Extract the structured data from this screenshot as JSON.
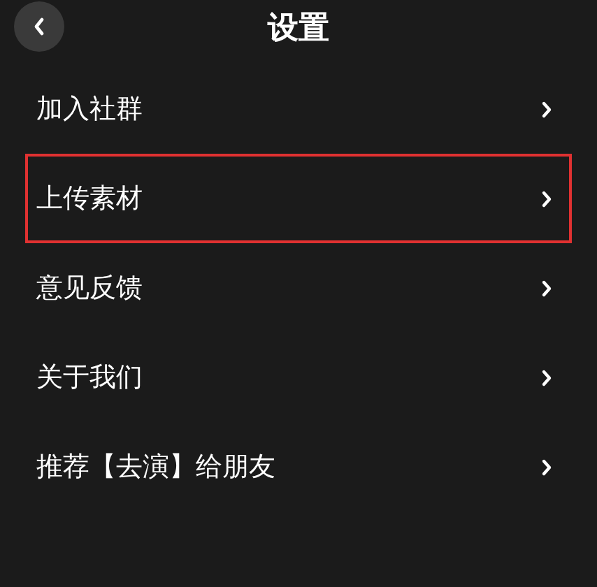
{
  "header": {
    "title": "设置"
  },
  "items": [
    {
      "label": "加入社群",
      "highlighted": false
    },
    {
      "label": "上传素材",
      "highlighted": true
    },
    {
      "label": "意见反馈",
      "highlighted": false
    },
    {
      "label": "关于我们",
      "highlighted": false
    },
    {
      "label": "推荐【去演】给朋友",
      "highlighted": false
    }
  ]
}
